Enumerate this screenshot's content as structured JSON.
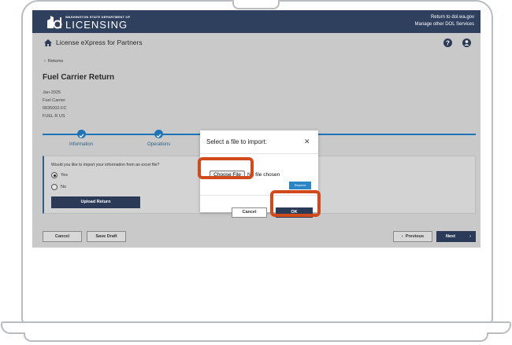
{
  "header": {
    "logo_small": "WASHINGTON STATE DEPARTMENT OF",
    "logo_big": "LICENSING",
    "links": [
      "Return to dol.wa.gov",
      "Manage other DOL Services"
    ]
  },
  "appbar": {
    "title": "License eXpress for Partners",
    "icons": [
      "home-icon",
      "help-icon",
      "user-icon"
    ]
  },
  "page": {
    "back_label": "Returns",
    "title": "Fuel Carrier Return",
    "meta": [
      "Jan-2025",
      "Fuel Carrier",
      "0835002-FC",
      "FUEL R US"
    ]
  },
  "stepper": {
    "steps": [
      "Information",
      "Operations"
    ]
  },
  "question": {
    "text": "Would you like to import your information from an excel file?",
    "options": [
      "Yes",
      "No"
    ],
    "selected": "Yes",
    "upload_label": "Upload Return"
  },
  "footer": {
    "cancel_label": "Cancel",
    "save_label": "Save Draft",
    "previous_label": "Previous",
    "next_label": "Next"
  },
  "modal": {
    "title": "Select a file to import:",
    "close": "✕",
    "file_button": "Choose File",
    "file_status": "No file chosen",
    "required_label": "Required",
    "cancel_label": "Cancel",
    "ok_label": "OK"
  },
  "colors": {
    "header_bg": "#2f3f5e",
    "accent": "#1e74b8",
    "primary_button": "#2b3a57",
    "highlight": "#d04a1b"
  }
}
